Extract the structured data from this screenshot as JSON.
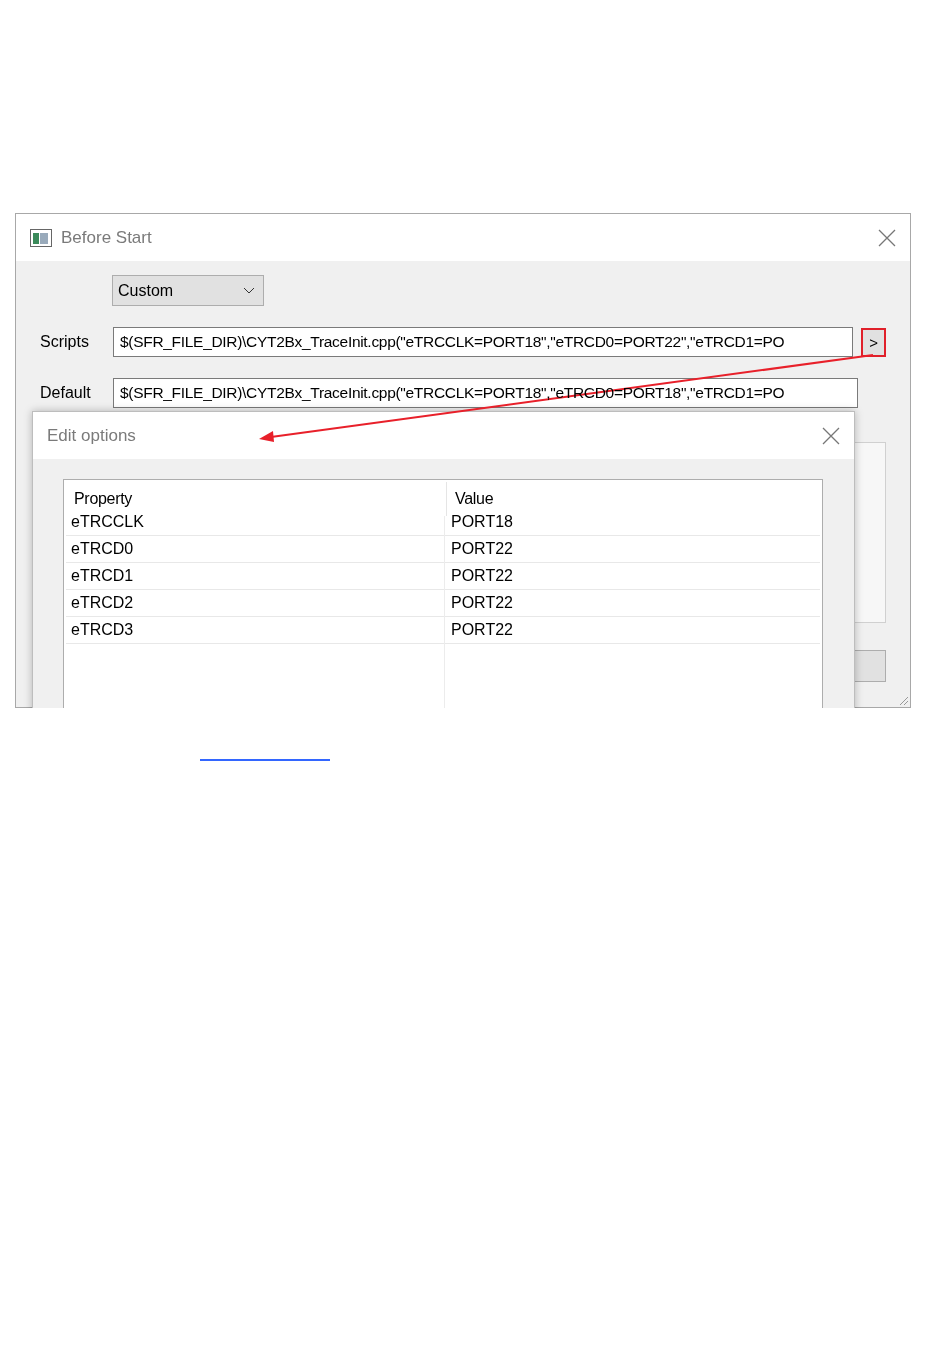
{
  "window": {
    "title": "Before Start"
  },
  "preset": {
    "value": "Custom"
  },
  "fields": [
    {
      "label": "Scripts",
      "value": "$(SFR_FILE_DIR)\\CYT2Bx_TraceInit.cpp(\"eTRCCLK=PORT18\",\"eTRCD0=PORT22\",\"eTRCD1=PO",
      "button": ">",
      "highlighted": true
    },
    {
      "label": "Default",
      "value": "$(SFR_FILE_DIR)\\CYT2Bx_TraceInit.cpp(\"eTRCCLK=PORT18\",\"eTRCD0=PORT18\",\"eTRCD1=PO"
    }
  ],
  "edit_dialog": {
    "title": "Edit options",
    "columns": [
      "Property",
      "Value"
    ],
    "rows": [
      {
        "property": "eTRCCLK",
        "value": "PORT18"
      },
      {
        "property": "eTRCD0",
        "value": "PORT22"
      },
      {
        "property": "eTRCD1",
        "value": "PORT22"
      },
      {
        "property": "eTRCD2",
        "value": "PORT22"
      },
      {
        "property": "eTRCD3",
        "value": "PORT22"
      }
    ]
  }
}
